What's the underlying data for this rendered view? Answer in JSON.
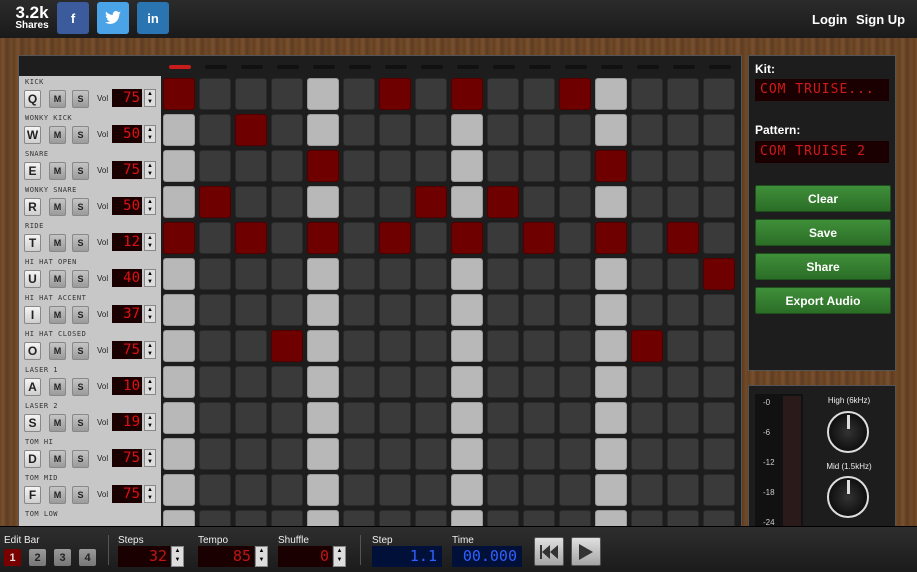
{
  "header": {
    "share_count": "3.2k",
    "share_label": "Shares",
    "facebook_label": "f",
    "twitter_label": "t",
    "linkedin_label": "in",
    "login_label": "Login",
    "signup_label": "Sign Up"
  },
  "sequencer": {
    "active_step": 1,
    "tracks": [
      {
        "name": "KICK",
        "key": "Q",
        "mute": "M",
        "solo": "S",
        "vol_label": "Vol",
        "volume": "75",
        "steps": [
          1,
          0,
          0,
          0,
          0,
          0,
          1,
          0,
          1,
          0,
          0,
          1,
          0,
          0,
          0,
          0
        ]
      },
      {
        "name": "WONKY KICK",
        "key": "W",
        "mute": "M",
        "solo": "S",
        "vol_label": "Vol",
        "volume": "50",
        "steps": [
          0,
          0,
          1,
          0,
          0,
          0,
          0,
          0,
          0,
          0,
          0,
          0,
          0,
          0,
          0,
          0
        ]
      },
      {
        "name": "SNARE",
        "key": "E",
        "mute": "M",
        "solo": "S",
        "vol_label": "Vol",
        "volume": "75",
        "steps": [
          0,
          0,
          0,
          0,
          1,
          0,
          0,
          0,
          0,
          0,
          0,
          0,
          1,
          0,
          0,
          0
        ]
      },
      {
        "name": "WONKY SNARE",
        "key": "R",
        "mute": "M",
        "solo": "S",
        "vol_label": "Vol",
        "volume": "50",
        "steps": [
          0,
          1,
          0,
          0,
          0,
          0,
          0,
          1,
          0,
          1,
          0,
          0,
          0,
          0,
          0,
          0
        ]
      },
      {
        "name": "RIDE",
        "key": "T",
        "mute": "M",
        "solo": "S",
        "vol_label": "Vol",
        "volume": "12",
        "steps": [
          1,
          0,
          1,
          0,
          1,
          0,
          1,
          0,
          1,
          0,
          1,
          0,
          1,
          0,
          1,
          0
        ]
      },
      {
        "name": "HI HAT OPEN",
        "key": "U",
        "mute": "M",
        "solo": "S",
        "vol_label": "Vol",
        "volume": "40",
        "steps": [
          0,
          0,
          0,
          0,
          0,
          0,
          0,
          0,
          0,
          0,
          0,
          0,
          0,
          0,
          0,
          1
        ]
      },
      {
        "name": "HI HAT ACCENT",
        "key": "I",
        "mute": "M",
        "solo": "S",
        "vol_label": "Vol",
        "volume": "37",
        "steps": [
          0,
          0,
          0,
          0,
          0,
          0,
          0,
          0,
          0,
          0,
          0,
          0,
          0,
          0,
          0,
          0
        ]
      },
      {
        "name": "HI HAT CLOSED",
        "key": "O",
        "mute": "M",
        "solo": "S",
        "vol_label": "Vol",
        "volume": "75",
        "steps": [
          0,
          0,
          0,
          1,
          0,
          0,
          0,
          0,
          0,
          0,
          0,
          0,
          0,
          1,
          0,
          0
        ]
      },
      {
        "name": "LASER 1",
        "key": "A",
        "mute": "M",
        "solo": "S",
        "vol_label": "Vol",
        "volume": "10",
        "steps": [
          0,
          0,
          0,
          0,
          0,
          0,
          0,
          0,
          0,
          0,
          0,
          0,
          0,
          0,
          0,
          0
        ]
      },
      {
        "name": "LASER 2",
        "key": "S",
        "mute": "M",
        "solo": "S",
        "vol_label": "Vol",
        "volume": "19",
        "steps": [
          0,
          0,
          0,
          0,
          0,
          0,
          0,
          0,
          0,
          0,
          0,
          0,
          0,
          0,
          0,
          0
        ]
      },
      {
        "name": "TOM HI",
        "key": "D",
        "mute": "M",
        "solo": "S",
        "vol_label": "Vol",
        "volume": "75",
        "steps": [
          0,
          0,
          0,
          0,
          0,
          0,
          0,
          0,
          0,
          0,
          0,
          0,
          0,
          0,
          0,
          0
        ]
      },
      {
        "name": "TOM MID",
        "key": "F",
        "mute": "M",
        "solo": "S",
        "vol_label": "Vol",
        "volume": "75",
        "steps": [
          0,
          0,
          0,
          0,
          0,
          0,
          0,
          0,
          0,
          0,
          0,
          0,
          0,
          0,
          0,
          0
        ]
      },
      {
        "name": "TOM LOW",
        "key": "",
        "mute": "",
        "solo": "",
        "vol_label": "",
        "volume": "",
        "steps": [
          0,
          0,
          0,
          0,
          0,
          0,
          0,
          0,
          0,
          0,
          0,
          0,
          0,
          0,
          0,
          0
        ]
      }
    ]
  },
  "sidebar": {
    "kit_label": "Kit:",
    "kit_value": "COM TRUISE...",
    "pattern_label": "Pattern:",
    "pattern_value": "COM TRUISE 2",
    "clear_label": "Clear",
    "save_label": "Save",
    "share_label": "Share",
    "export_label": "Export Audio"
  },
  "eq": {
    "meter_ticks": [
      "-0",
      "-6",
      "-12",
      "-18",
      "-24"
    ],
    "high_label": "High (6kHz)",
    "mid_label": "Mid (1.5kHz)"
  },
  "transport": {
    "edit_bar_label": "Edit Bar",
    "bars": [
      "1",
      "2",
      "3",
      "4"
    ],
    "active_bar": 0,
    "steps_label": "Steps",
    "steps_value": "32",
    "tempo_label": "Tempo",
    "tempo_value": "85",
    "shuffle_label": "Shuffle",
    "shuffle_value": "0",
    "step_label": "Step",
    "step_value": "1.1",
    "time_label": "Time",
    "time_value": "00.000"
  },
  "colors": {
    "active_step": "#6e0000",
    "beat_cell": "#b8b8b8",
    "empty_cell": "#3a3a3a",
    "button_green": "#2b6e27"
  }
}
